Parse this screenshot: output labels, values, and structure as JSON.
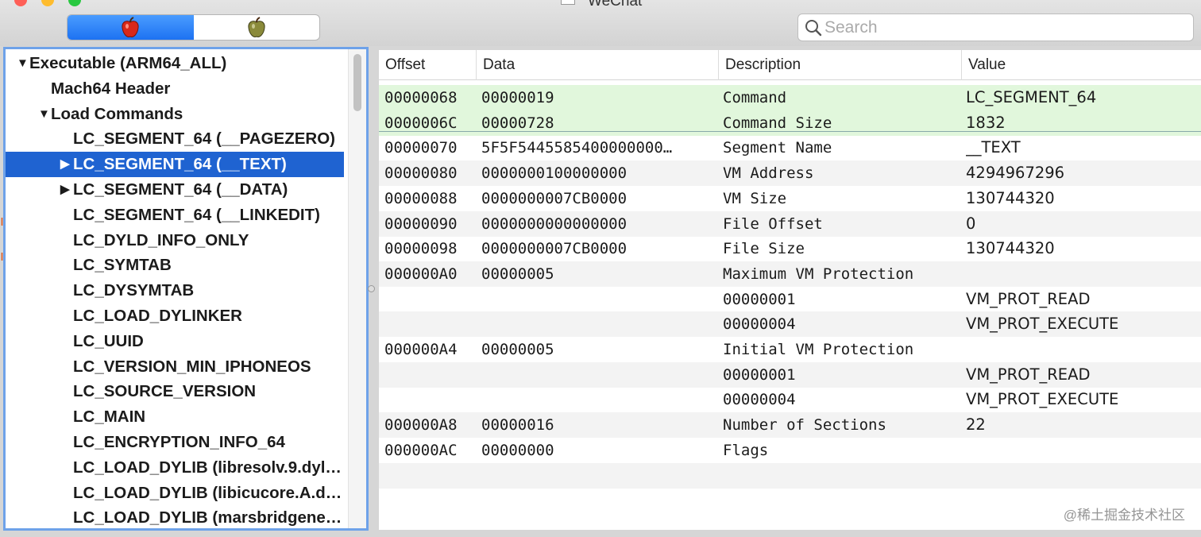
{
  "window": {
    "title": "WeChat"
  },
  "toolbar": {
    "view_buttons": [
      {
        "name": "red-apple",
        "color": "#d8281a"
      },
      {
        "name": "green-apple",
        "color": "#8a8a3a"
      }
    ],
    "search": {
      "placeholder": "Search",
      "value": ""
    }
  },
  "outline": {
    "rows": [
      {
        "label": "Executable  (ARM64_ALL)",
        "arrow": "▼",
        "depth": 0
      },
      {
        "label": "Mach64 Header",
        "arrow": "",
        "depth": 1
      },
      {
        "label": "Load Commands",
        "arrow": "▼",
        "depth": 1
      },
      {
        "label": "LC_SEGMENT_64 (__PAGEZERO)",
        "arrow": "",
        "depth": 2
      },
      {
        "label": "LC_SEGMENT_64 (__TEXT)",
        "arrow": "▶",
        "depth": 2,
        "selected": true
      },
      {
        "label": "LC_SEGMENT_64 (__DATA)",
        "arrow": "▶",
        "depth": 2
      },
      {
        "label": "LC_SEGMENT_64 (__LINKEDIT)",
        "arrow": "",
        "depth": 2
      },
      {
        "label": "LC_DYLD_INFO_ONLY",
        "arrow": "",
        "depth": 2
      },
      {
        "label": "LC_SYMTAB",
        "arrow": "",
        "depth": 2
      },
      {
        "label": "LC_DYSYMTAB",
        "arrow": "",
        "depth": 2
      },
      {
        "label": "LC_LOAD_DYLINKER",
        "arrow": "",
        "depth": 2
      },
      {
        "label": "LC_UUID",
        "arrow": "",
        "depth": 2
      },
      {
        "label": "LC_VERSION_MIN_IPHONEOS",
        "arrow": "",
        "depth": 2
      },
      {
        "label": "LC_SOURCE_VERSION",
        "arrow": "",
        "depth": 2
      },
      {
        "label": "LC_MAIN",
        "arrow": "",
        "depth": 2
      },
      {
        "label": "LC_ENCRYPTION_INFO_64",
        "arrow": "",
        "depth": 2
      },
      {
        "label": "LC_LOAD_DYLIB (libresolv.9.dyl…",
        "arrow": "",
        "depth": 2
      },
      {
        "label": "LC_LOAD_DYLIB (libicucore.A.d…",
        "arrow": "",
        "depth": 2
      },
      {
        "label": "LC_LOAD_DYLIB (marsbridgene…",
        "arrow": "",
        "depth": 2
      }
    ]
  },
  "table": {
    "columns": [
      "Offset",
      "Data",
      "Description",
      "Value"
    ],
    "rows": [
      {
        "offset": "00000068",
        "data": "00000019",
        "description": "Command",
        "value": "LC_SEGMENT_64",
        "highlight": true
      },
      {
        "offset": "0000006C",
        "data": "00000728",
        "description": "Command Size",
        "value": "1832",
        "highlight": true
      },
      {
        "offset": "00000070",
        "data": "5F5F5445585400000000…",
        "description": "Segment Name",
        "value": "__TEXT"
      },
      {
        "offset": "00000080",
        "data": "0000000100000000",
        "description": "VM Address",
        "value": "4294967296"
      },
      {
        "offset": "00000088",
        "data": "0000000007CB0000",
        "description": "VM Size",
        "value": "130744320"
      },
      {
        "offset": "00000090",
        "data": "0000000000000000",
        "description": "File Offset",
        "value": "0"
      },
      {
        "offset": "00000098",
        "data": "0000000007CB0000",
        "description": "File Size",
        "value": "130744320"
      },
      {
        "offset": "000000A0",
        "data": "00000005",
        "description": "Maximum VM Protection",
        "value": ""
      },
      {
        "offset": "",
        "data": "",
        "description": "00000001",
        "value": "VM_PROT_READ"
      },
      {
        "offset": "",
        "data": "",
        "description": "00000004",
        "value": "VM_PROT_EXECUTE"
      },
      {
        "offset": "000000A4",
        "data": "00000005",
        "description": "Initial VM Protection",
        "value": ""
      },
      {
        "offset": "",
        "data": "",
        "description": "00000001",
        "value": "VM_PROT_READ"
      },
      {
        "offset": "",
        "data": "",
        "description": "00000004",
        "value": "VM_PROT_EXECUTE"
      },
      {
        "offset": "000000A8",
        "data": "00000016",
        "description": "Number of Sections",
        "value": "22"
      },
      {
        "offset": "000000AC",
        "data": "00000000",
        "description": "Flags",
        "value": ""
      },
      {
        "offset": "",
        "data": "",
        "description": "",
        "value": ""
      },
      {
        "offset": "",
        "data": "",
        "description": "",
        "value": ""
      }
    ]
  },
  "watermark": "@稀土掘金技术社区"
}
